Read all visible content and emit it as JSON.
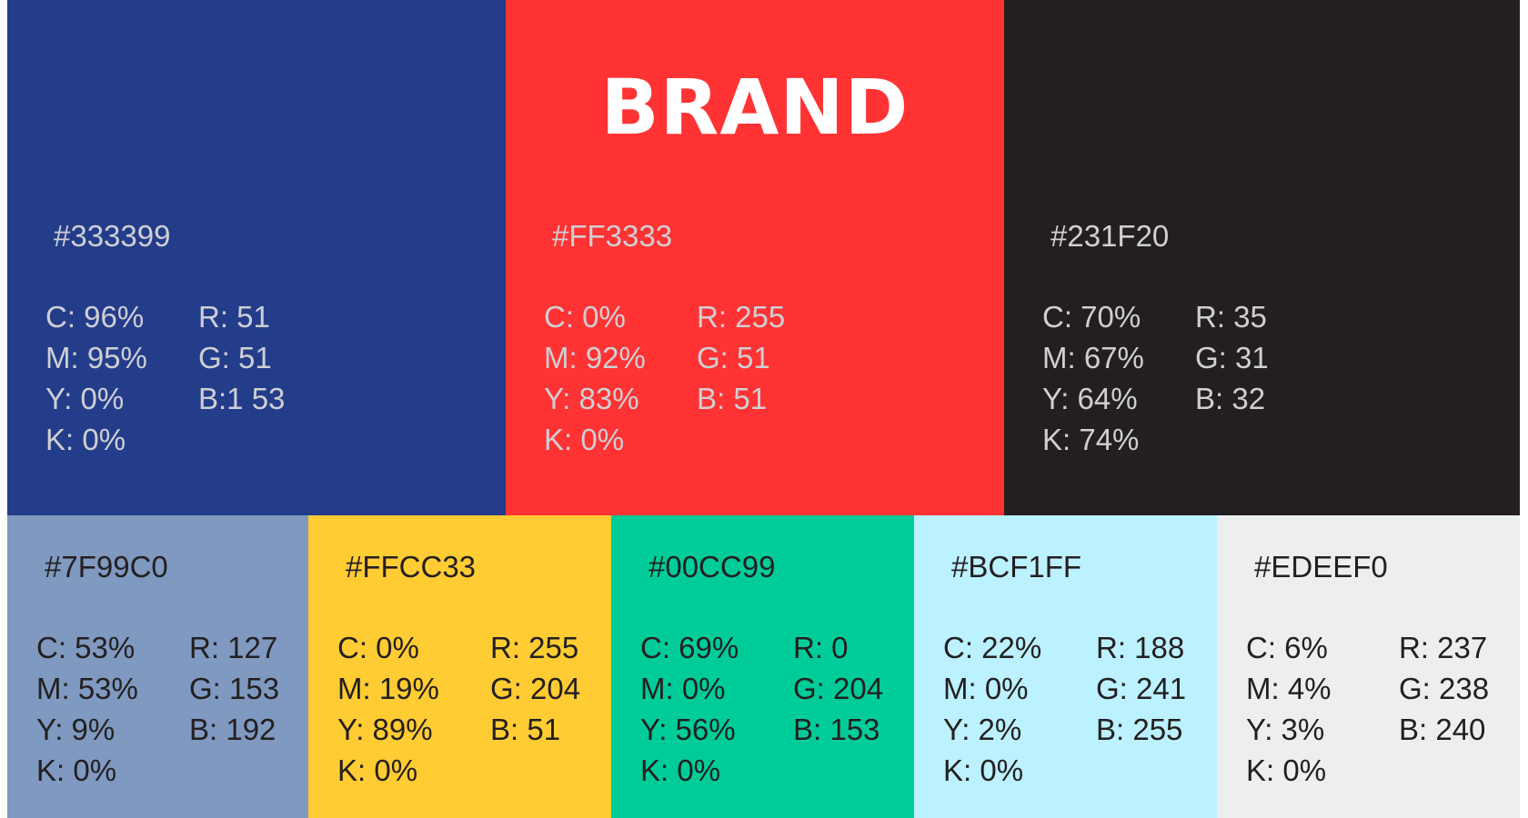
{
  "title": "BRAND",
  "swatches": [
    {
      "hex": "#333399",
      "color": "#233D8A",
      "c": "C: 96%",
      "m": "M: 95%",
      "y": "Y: 0%",
      "k": "K: 0%",
      "r": "R: 51",
      "g": "G: 51",
      "b": "B:1 53"
    },
    {
      "hex": "#FF3333",
      "color": "#FF3333",
      "c": "C: 0%",
      "m": "M: 92%",
      "y": "Y: 83%",
      "k": "K: 0%",
      "r": "R: 255",
      "g": "G: 51",
      "b": "B: 51"
    },
    {
      "hex": "#231F20",
      "color": "#231F20",
      "c": "C: 70%",
      "m": "M: 67%",
      "y": "Y: 64%",
      "k": "K: 74%",
      "r": "R: 35",
      "g": "G: 31",
      "b": "B: 32"
    },
    {
      "hex": "#7F99C0",
      "color": "#7F99C0",
      "c": "C: 53%",
      "m": "M: 53%",
      "y": "Y: 9%",
      "k": "K: 0%",
      "r": "R: 127",
      "g": "G: 153",
      "b": "B: 192"
    },
    {
      "hex": "#FFCC33",
      "color": "#FFCC33",
      "c": "C: 0%",
      "m": "M: 19%",
      "y": "Y: 89%",
      "k": "K: 0%",
      "r": "R: 255",
      "g": "G: 204",
      "b": "B: 51"
    },
    {
      "hex": "#00CC99",
      "color": "#00CC99",
      "c": "C: 69%",
      "m": "M: 0%",
      "y": "Y: 56%",
      "k": "K: 0%",
      "r": "R: 0",
      "g": "G: 204",
      "b": "B: 153"
    },
    {
      "hex": "#BCF1FF",
      "color": "#BCF1FF",
      "c": "C: 22%",
      "m": "M: 0%",
      "y": "Y: 2%",
      "k": "K: 0%",
      "r": "R: 188",
      "g": "G: 241",
      "b": "B: 255"
    },
    {
      "hex": "#EDEEF0",
      "color": "#EDEEF0",
      "c": "C: 6%",
      "m": "M: 4%",
      "y": "Y: 3%",
      "k": "K: 0%",
      "r": "R: 237",
      "g": "G: 238",
      "b": "B: 240"
    }
  ]
}
